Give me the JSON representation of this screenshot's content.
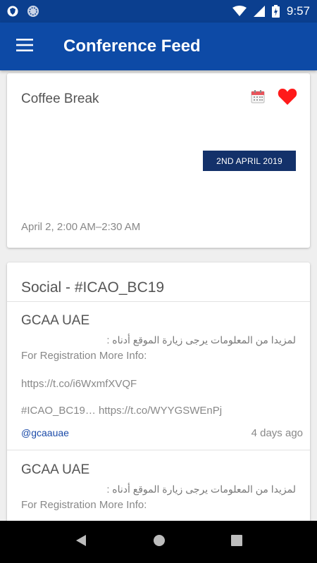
{
  "status_bar": {
    "time": "9:57",
    "icons": [
      "shield-app-icon",
      "sync-circle-icon",
      "wifi-icon",
      "signal-icon",
      "battery-charging-icon"
    ]
  },
  "app_bar": {
    "title": "Conference Feed",
    "menu_icon": "hamburger-menu-icon"
  },
  "event_card": {
    "title": "Coffee Break",
    "date_badge": "2ND APRIL 2019",
    "time_range": "April 2, 2:00 AM–2:30 AM",
    "favorite": true,
    "icons": [
      "calendar-icon",
      "heart-icon"
    ],
    "colors": {
      "heart": "#ff1a1a",
      "badge": "#13316a"
    }
  },
  "social_card": {
    "title": "Social - #ICAO_BC19",
    "posts": [
      {
        "author": "GCAA UAE",
        "arabic_text": "لمزيدا من المعلومات يرجى زيارة الموقع أدناه :",
        "line1": "For Registration  More Info:",
        "line2": "https://t.co/i6WxmfXVQF",
        "line3": "#ICAO_BC19… https://t.co/WYYGSWEnPj",
        "handle": "@gcaauae",
        "ago": "4 days ago"
      },
      {
        "author": "GCAA UAE",
        "arabic_text": "لمزيدا من المعلومات يرجى زيارة الموقع أدناه :",
        "line1": "For Registration  More Info:"
      }
    ]
  },
  "nav_bar": {
    "icons": [
      "back-icon",
      "home-icon",
      "recents-icon"
    ]
  },
  "colors": {
    "status_bar": "#0b3f8f",
    "app_bar": "#0d4aa6",
    "link": "#1a4aa8"
  }
}
